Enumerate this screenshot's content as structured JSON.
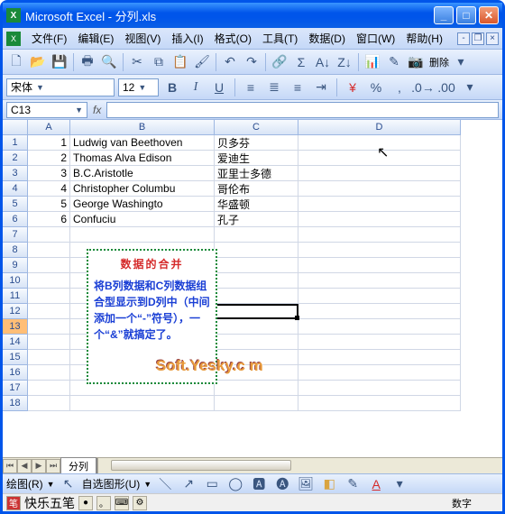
{
  "window": {
    "title": "Microsoft Excel - 分列.xls"
  },
  "menus": {
    "file": "文件(F)",
    "edit": "编辑(E)",
    "view": "视图(V)",
    "insert": "插入(I)",
    "format": "格式(O)",
    "tools": "工具(T)",
    "data": "数据(D)",
    "window": "窗口(W)",
    "help": "帮助(H)"
  },
  "font": {
    "name": "宋体",
    "size": "12"
  },
  "namebox": "C13",
  "fx_label": "fx",
  "columns": [
    "A",
    "B",
    "C",
    "D"
  ],
  "rows_count": 18,
  "data_rows": [
    {
      "a": "1",
      "b": "Ludwig van Beethoven",
      "c": "贝多芬"
    },
    {
      "a": "2",
      "b": "Thomas Alva Edison",
      "c": "爱迪生"
    },
    {
      "a": "3",
      "b": "B.C.Aristotle",
      "c": "亚里士多德"
    },
    {
      "a": "4",
      "b": "Christopher Columbu",
      "c": "哥伦布"
    },
    {
      "a": "5",
      "b": "George Washingto",
      "c": "华盛顿"
    },
    {
      "a": "6",
      "b": "Confuciu",
      "c": "孔子"
    }
  ],
  "textbox": {
    "title": "数据的合并",
    "body": "将B列数据和C列数据组合型显示到D列中（中间添加一个“-”符号），一个“&”就搞定了。"
  },
  "sheet_tab": "分列",
  "draw": {
    "label": "绘图(R)",
    "autoshape": "自选图形(U)"
  },
  "ime": {
    "name": "快乐五笔"
  },
  "status": {
    "mode": "数字"
  },
  "watermark": "Soft.Yesky.c  m",
  "toolbar_del": "删除"
}
